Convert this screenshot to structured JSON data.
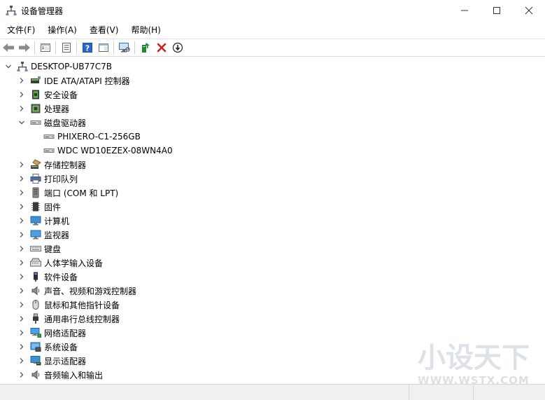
{
  "window": {
    "title": "设备管理器"
  },
  "menu": [
    "文件(F)",
    "操作(A)",
    "查看(V)",
    "帮助(H)"
  ],
  "tree": {
    "root": "DESKTOP-UB77C7B",
    "categories": [
      {
        "label": "IDE ATA/ATAPI 控制器",
        "icon": "ide-controller-icon"
      },
      {
        "label": "安全设备",
        "icon": "security-device-icon"
      },
      {
        "label": "处理器",
        "icon": "processor-icon"
      },
      {
        "label": "磁盘驱动器",
        "icon": "disk-drive-icon",
        "expanded": true,
        "children": [
          "PHIXERO-C1-256GB",
          "WDC WD10EZEX-08WN4A0"
        ]
      },
      {
        "label": "存储控制器",
        "icon": "storage-controller-icon"
      },
      {
        "label": "打印队列",
        "icon": "printer-icon"
      },
      {
        "label": "端口 (COM 和 LPT)",
        "icon": "port-icon"
      },
      {
        "label": "固件",
        "icon": "firmware-icon"
      },
      {
        "label": "计算机",
        "icon": "computer-icon"
      },
      {
        "label": "监视器",
        "icon": "monitor-icon"
      },
      {
        "label": "键盘",
        "icon": "keyboard-icon"
      },
      {
        "label": "人体学输入设备",
        "icon": "hid-icon"
      },
      {
        "label": "软件设备",
        "icon": "software-device-icon"
      },
      {
        "label": "声音、视频和游戏控制器",
        "icon": "speaker-icon"
      },
      {
        "label": "鼠标和其他指针设备",
        "icon": "mouse-icon"
      },
      {
        "label": "通用串行总线控制器",
        "icon": "usb-icon"
      },
      {
        "label": "网络适配器",
        "icon": "network-adapter-icon"
      },
      {
        "label": "系统设备",
        "icon": "system-device-icon"
      },
      {
        "label": "显示适配器",
        "icon": "display-adapter-icon"
      },
      {
        "label": "音频输入和输出",
        "icon": "audio-io-icon"
      }
    ]
  },
  "watermark": {
    "text": "小设天下",
    "sub": "WWW.WSTX.COM"
  },
  "colors": {
    "accent": "#2a67c9",
    "delete": "#d32020",
    "enable": "#1f8a2e"
  }
}
